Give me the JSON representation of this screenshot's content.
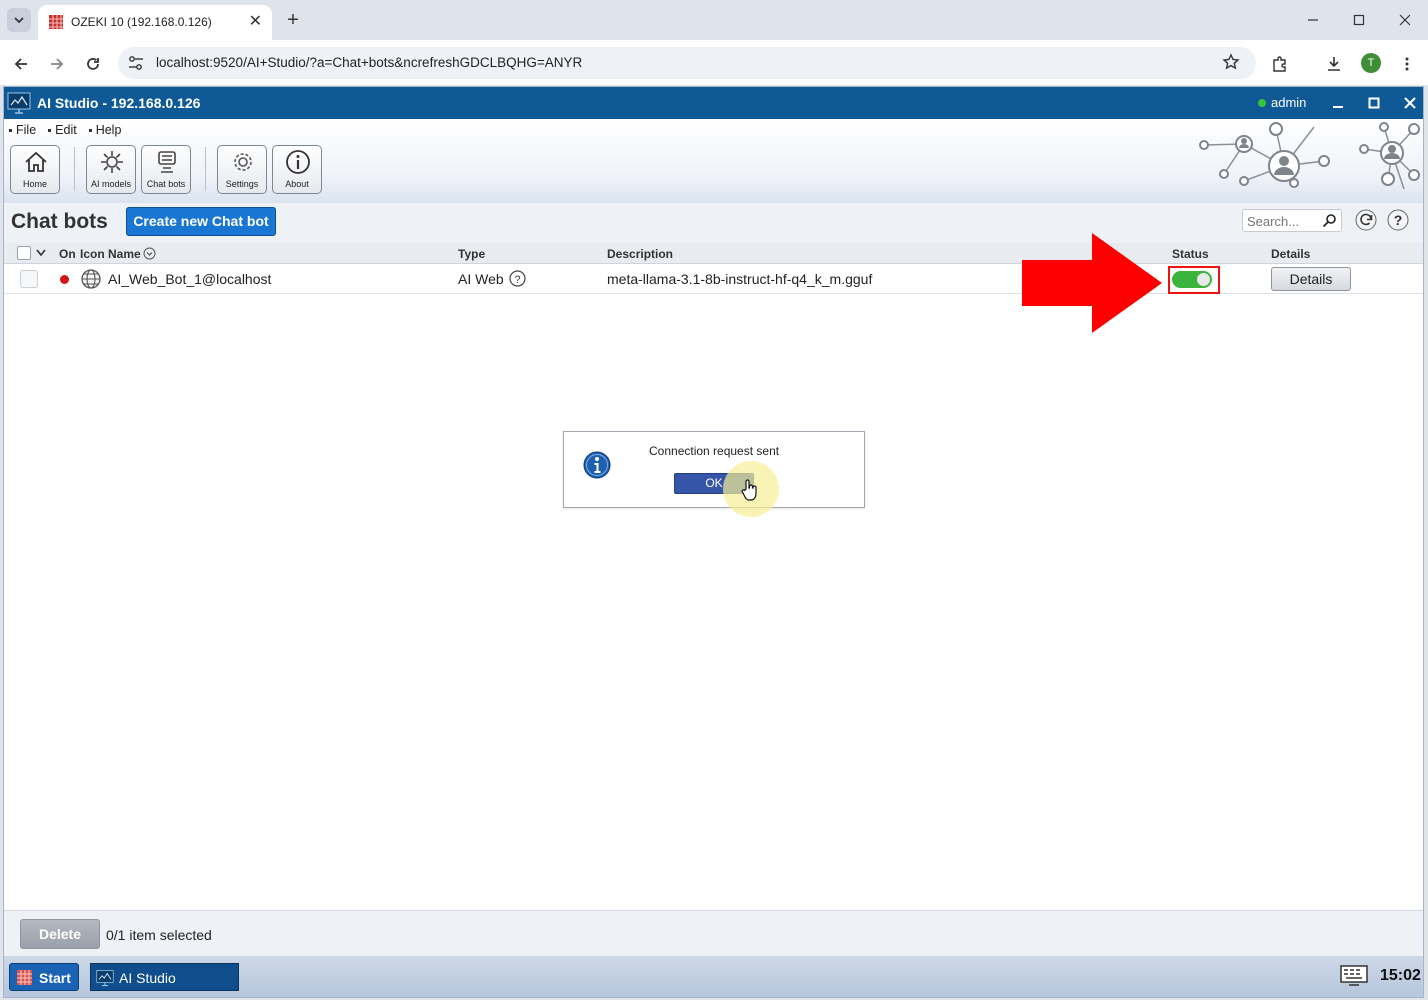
{
  "browser": {
    "tab_title": "OZEKI 10 (192.168.0.126)",
    "new_tab_symbol": "+",
    "url": "localhost:9520/AI+Studio/?a=Chat+bots&ncrefreshGDCLBQHG=ANYR",
    "profile_initial": "T"
  },
  "app": {
    "title": "AI Studio - 192.168.0.126",
    "user": "admin",
    "menu": [
      "File",
      "Edit",
      "Help"
    ],
    "tools": {
      "home": "Home",
      "ai_models": "AI models",
      "chat_bots": "Chat bots",
      "settings": "Settings",
      "about": "About"
    }
  },
  "page": {
    "title": "Chat bots",
    "create_button": "Create new Chat bot",
    "search_placeholder": "Search..."
  },
  "table": {
    "headers": {
      "on": "On",
      "icon": "Icon",
      "name": "Name",
      "type": "Type",
      "description": "Description",
      "status": "Status",
      "details": "Details"
    },
    "rows": [
      {
        "name": "AI_Web_Bot_1@localhost",
        "type": "AI Web",
        "description": "meta-llama-3.1-8b-instruct-hf-q4_k_m.gguf",
        "status_on": true,
        "details_button": "Details"
      }
    ]
  },
  "dialog": {
    "message": "Connection request sent",
    "ok": "OK"
  },
  "footer": {
    "delete": "Delete",
    "selection": "0/1 item selected"
  },
  "taskbar": {
    "start": "Start",
    "task": "AI Studio",
    "clock": "15:02"
  },
  "colors": {
    "title_bar": "#0f5a96",
    "accent_button": "#1976d2",
    "toggle_on": "#3ab43c",
    "highlight_arrow": "#ff0000"
  }
}
